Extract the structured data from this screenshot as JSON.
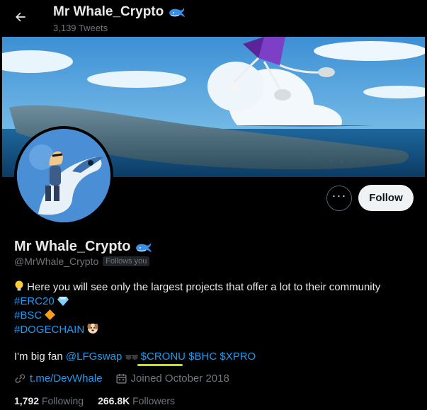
{
  "header": {
    "title": "Mr Whale_Crypto",
    "tweet_count": "3,139 Tweets"
  },
  "actions": {
    "more": "···",
    "follow": "Follow"
  },
  "profile": {
    "display_name": "Mr Whale_Crypto",
    "handle": "@MrWhale_Crypto",
    "follows_you": "Follows you",
    "bio": [
      "Here you will see only the largest projects that offer a lot to their community",
      "#ERC20",
      "#BSC",
      "#DOGECHAIN"
    ],
    "fan_prefix": "I'm big fan",
    "fan_mention": "@LFGswap",
    "fan_tags": [
      "$CRONU",
      "$BHC",
      "$XPRO"
    ],
    "link": "t.me/DevWhale",
    "joined": "Joined October 2018"
  },
  "stats": {
    "following_count": "1,792",
    "following_label": "Following",
    "followers_count": "266.8K",
    "followers_label": "Followers"
  },
  "colors": {
    "link": "#1d9bf0",
    "muted": "#71767b",
    "text": "#e7e9ea",
    "background": "#000000",
    "underline": "#c8d44a"
  }
}
